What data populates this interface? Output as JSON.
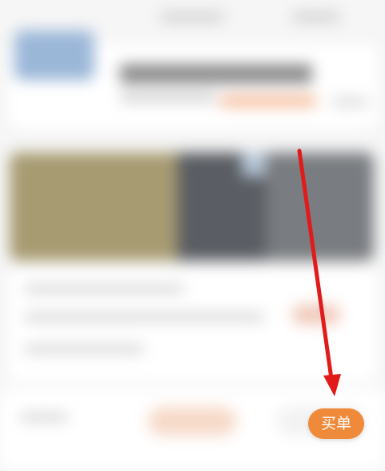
{
  "buy_button": {
    "label": "买单"
  },
  "annotation": {
    "color": "#e11a1a"
  },
  "colors": {
    "buy_button_bg": "#ef8a3a",
    "background": "#f6f6f6"
  }
}
